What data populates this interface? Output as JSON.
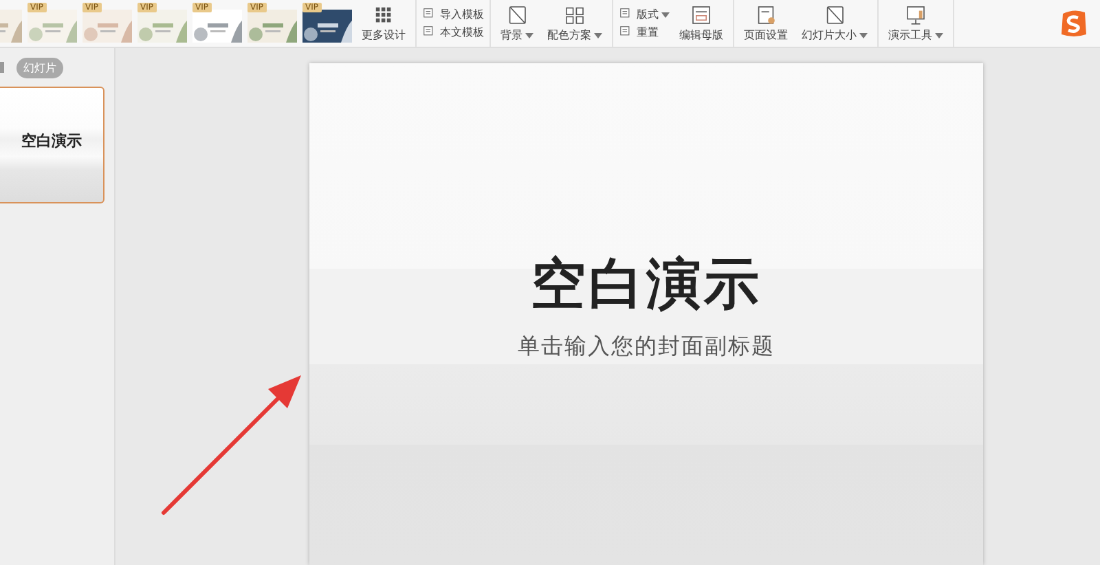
{
  "toolbar": {
    "templates": [
      {
        "kind": "picture"
      },
      {
        "kind": "picture",
        "badge": "VIP"
      },
      {
        "kind": "picture",
        "badge": "VIP"
      },
      {
        "kind": "picture",
        "badge": "VIP"
      },
      {
        "kind": "picture",
        "badge": "VIP"
      },
      {
        "kind": "picture",
        "badge": "VIP"
      },
      {
        "kind": "picture",
        "badge": "VIP"
      }
    ],
    "groups": [
      [
        {
          "kind": "big",
          "label": "更多设计",
          "dropdown": false
        }
      ],
      [
        {
          "kind": "stack",
          "items": [
            {
              "label": "导入模板",
              "dropdown": false
            },
            {
              "label": "本文模板",
              "dropdown": false
            }
          ]
        }
      ],
      [
        {
          "kind": "big",
          "label": "背景",
          "dropdown": true
        },
        {
          "kind": "big",
          "label": "配色方案",
          "dropdown": true
        }
      ],
      [
        {
          "kind": "stack",
          "items": [
            {
              "label": "版式",
              "dropdown": true
            },
            {
              "label": "重置",
              "dropdown": false
            }
          ]
        },
        {
          "kind": "big",
          "label": "编辑母版",
          "dropdown": false
        }
      ],
      [
        {
          "kind": "big",
          "label": "页面设置",
          "dropdown": false
        },
        {
          "kind": "big",
          "label": "幻灯片大小",
          "dropdown": true
        }
      ],
      [
        {
          "kind": "big",
          "label": "演示工具",
          "dropdown": true
        }
      ]
    ]
  },
  "sidebar": {
    "tab": "幻灯片",
    "thumbnails": [
      {
        "title": "空白演示",
        "selected": true
      }
    ]
  },
  "slide": {
    "title": "空白演示",
    "subtitle": "单击输入您的封面副标题"
  }
}
